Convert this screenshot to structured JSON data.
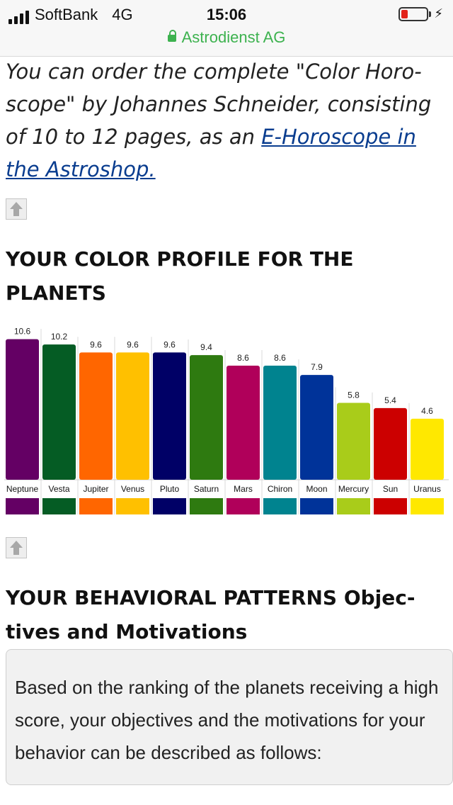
{
  "status_bar": {
    "carrier": "SoftBank",
    "network": "4G",
    "time": "15:06",
    "battery_level": 0.25,
    "battery_color": "#e2231a"
  },
  "browser": {
    "site": "Astrodienst AG",
    "secure_color": "#3db24f"
  },
  "intro": {
    "text_before": "You can order the complete \"Color Horo-scope\" by Johannes Schneider, consisting of 10 to 12 pages, as an ",
    "link": "E-Horoscope in the Astroshop.",
    "text_after": ""
  },
  "icons": {
    "back_to_top": "up-arrow-icon",
    "lock": "lock-icon",
    "charging": "lightning-icon"
  },
  "color_profile": {
    "heading": "YOUR COLOR PROFILE FOR THE PLANETS"
  },
  "chart_data": {
    "type": "bar",
    "categories": [
      "Neptune",
      "Vesta",
      "Jupiter",
      "Venus",
      "Pluto",
      "Saturn",
      "Mars",
      "Chiron",
      "Moon",
      "Mercury",
      "Sun",
      "Uranus"
    ],
    "values": [
      10.6,
      10.2,
      9.6,
      9.6,
      9.6,
      9.4,
      8.6,
      8.6,
      7.9,
      5.8,
      5.4,
      4.6
    ],
    "value_labels": [
      "10.6",
      "10.2",
      "9.6",
      "9.6",
      "9.6",
      "9.4",
      "8.6",
      "8.6",
      "7.9",
      "5.8",
      "5.4",
      "4.6"
    ],
    "colors": [
      "#640064",
      "#055c24",
      "#ff6600",
      "#ffc000",
      "#000066",
      "#2e7a10",
      "#b0005a",
      "#00838f",
      "#003399",
      "#a9cc1a",
      "#cc0000",
      "#ffe800"
    ],
    "title": "",
    "xlabel": "",
    "ylabel": "",
    "ylim": [
      0,
      10.9
    ],
    "grid": false,
    "legend": "color swatches below bars"
  },
  "behavior": {
    "heading": "YOUR BEHAVIORAL PATTERNS Objec-tives and Motivations",
    "text": "Based on the ranking of the planets receiving a high score, your objectives and the motivations for your behavior can be described as follows:"
  }
}
